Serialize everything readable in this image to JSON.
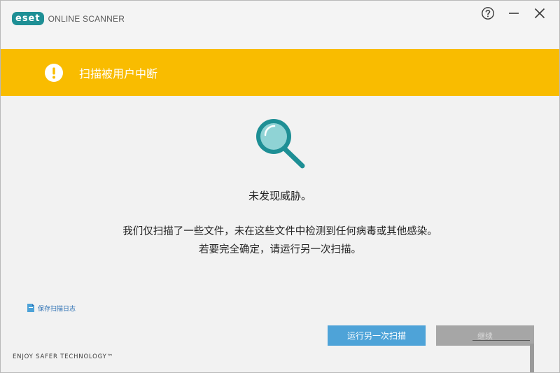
{
  "window": {
    "logo_badge": "eset",
    "logo_text": "ONLINE SCANNER"
  },
  "banner": {
    "message": "扫描被用户中断",
    "icon": "warning-icon",
    "color": "#f9bc00"
  },
  "result": {
    "icon": "magnifier-icon",
    "no_threat": "未发现威胁。",
    "line1": "我们仅扫描了一些文件，未在这些文件中检测到任何病毒或其他感染。",
    "line2": "若要完全确定，请运行另一次扫描。"
  },
  "links": {
    "save_log": "保存扫描日志",
    "save_log_icon": "save-document-icon"
  },
  "buttons": {
    "rescan": "运行另一次扫描",
    "continue": "继续"
  },
  "footer": {
    "tagline": "ENJOY SAFER TECHNOLOGY™"
  },
  "colors": {
    "accent": "#1e8f95",
    "warning": "#f9bc00",
    "primary_button": "#4ea3d8"
  }
}
